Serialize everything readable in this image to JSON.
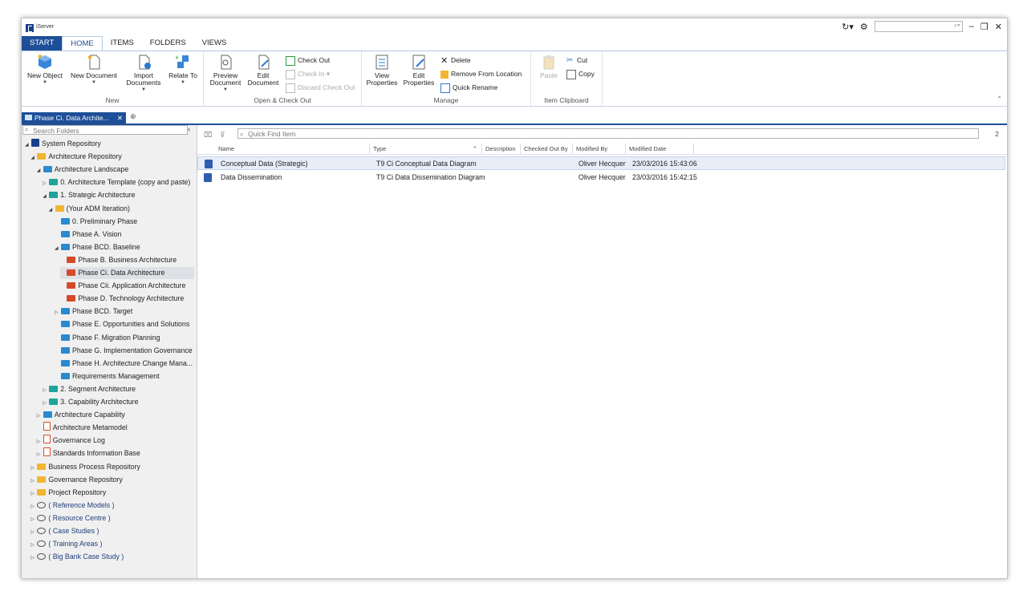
{
  "app": {
    "title": "iServer"
  },
  "ribbon_tabs": [
    "START",
    "HOME",
    "ITEMS",
    "FOLDERS",
    "VIEWS"
  ],
  "groups": {
    "new": {
      "label": "New",
      "new_object": "New Object",
      "new_document": "New Document",
      "import_documents_1": "Import",
      "import_documents_2": "Documents",
      "relate_to": "Relate To"
    },
    "open": {
      "label": "Open & Check Out",
      "preview_1": "Preview",
      "preview_2": "Document",
      "edit_1": "Edit",
      "edit_2": "Document",
      "check_out": "Check Out",
      "check_in": "Check In",
      "discard": "Discard Check Out"
    },
    "manage": {
      "label": "Manage",
      "view_1": "View",
      "view_2": "Properties",
      "editp_1": "Edit",
      "editp_2": "Properties",
      "delete": "Delete",
      "remove": "Remove From Location",
      "rename": "Quick Rename"
    },
    "clipboard": {
      "label": "Item Clipboard",
      "paste": "Paste",
      "cut": "Cut",
      "copy": "Copy"
    }
  },
  "doc_tab": {
    "label": "Phase Ci. Data Archite..."
  },
  "left": {
    "search_placeholder": "Search Folders"
  },
  "tree": [
    {
      "label": "System Repository",
      "indent": 0,
      "toggle": "◢",
      "icon": "sysicon",
      "name": "tree-system-repository"
    },
    {
      "label": "Architecture Repository",
      "indent": 1,
      "toggle": "◢",
      "icon": "f-orange",
      "name": "tree-architecture-repository"
    },
    {
      "label": "Architecture Landscape",
      "indent": 2,
      "toggle": "◢",
      "icon": "f-blue",
      "name": "tree-architecture-landscape"
    },
    {
      "label": "0. Architecture Template (copy and paste)",
      "indent": 3,
      "toggle": "▷",
      "icon": "f-teal",
      "name": "tree-architecture-template"
    },
    {
      "label": "1. Strategic Architecture",
      "indent": 3,
      "toggle": "◢",
      "icon": "f-teal",
      "name": "tree-strategic-architecture"
    },
    {
      "label": "(Your ADM Iteration)",
      "indent": 4,
      "toggle": "◢",
      "icon": "f-orange",
      "name": "tree-your-adm-iteration"
    },
    {
      "label": "0. Preliminary Phase",
      "indent": 5,
      "toggle": "",
      "icon": "f-blue",
      "name": "tree-preliminary-phase"
    },
    {
      "label": "Phase A. Vision",
      "indent": 5,
      "toggle": "",
      "icon": "f-blue",
      "name": "tree-phase-a-vision"
    },
    {
      "label": "Phase BCD. Baseline",
      "indent": 5,
      "toggle": "◢",
      "icon": "f-blue",
      "name": "tree-phase-bcd-baseline"
    },
    {
      "label": "Phase B. Business Architecture",
      "indent": 6,
      "toggle": "",
      "icon": "f-red",
      "name": "tree-phase-b-business"
    },
    {
      "label": "Phase Ci. Data Architecture",
      "indent": 6,
      "toggle": "",
      "icon": "f-red",
      "name": "tree-phase-ci-data",
      "sel": true
    },
    {
      "label": "Phase Cii. Application Architecture",
      "indent": 6,
      "toggle": "",
      "icon": "f-red",
      "name": "tree-phase-cii-application"
    },
    {
      "label": "Phase D. Technology Architecture",
      "indent": 6,
      "toggle": "",
      "icon": "f-red",
      "name": "tree-phase-d-technology"
    },
    {
      "label": "Phase BCD. Target",
      "indent": 5,
      "toggle": "▷",
      "icon": "f-blue",
      "name": "tree-phase-bcd-target"
    },
    {
      "label": "Phase E. Opportunities and Solutions",
      "indent": 5,
      "toggle": "",
      "icon": "f-blue",
      "name": "tree-phase-e"
    },
    {
      "label": "Phase F. Migration Planning",
      "indent": 5,
      "toggle": "",
      "icon": "f-blue",
      "name": "tree-phase-f"
    },
    {
      "label": "Phase G. Implementation Governance",
      "indent": 5,
      "toggle": "",
      "icon": "f-blue",
      "name": "tree-phase-g"
    },
    {
      "label": "Phase H. Architecture Change Mana...",
      "indent": 5,
      "toggle": "",
      "icon": "f-blue",
      "name": "tree-phase-h"
    },
    {
      "label": "Requirements Management",
      "indent": 5,
      "toggle": "",
      "icon": "f-blue",
      "name": "tree-requirements-management"
    },
    {
      "label": "2. Segment Architecture",
      "indent": 3,
      "toggle": "▷",
      "icon": "f-teal",
      "name": "tree-segment-architecture"
    },
    {
      "label": "3. Capability Architecture",
      "indent": 3,
      "toggle": "▷",
      "icon": "f-teal",
      "name": "tree-capability-architecture"
    },
    {
      "label": "Architecture Capability",
      "indent": 2,
      "toggle": "▷",
      "icon": "f-blue",
      "name": "tree-architecture-capability"
    },
    {
      "label": "Architecture Metamodel",
      "indent": 2,
      "toggle": "",
      "icon": "doc-red",
      "name": "tree-architecture-metamodel"
    },
    {
      "label": "Governance Log",
      "indent": 2,
      "toggle": "▷",
      "icon": "doc-red",
      "name": "tree-governance-log"
    },
    {
      "label": "Standards Information Base",
      "indent": 2,
      "toggle": "▷",
      "icon": "doc-red",
      "name": "tree-standards-information-base"
    },
    {
      "label": "Business Process Repository",
      "indent": 1,
      "toggle": "▷",
      "icon": "f-orange",
      "name": "tree-business-process-repository"
    },
    {
      "label": "Governance Repository",
      "indent": 1,
      "toggle": "▷",
      "icon": "f-orange",
      "name": "tree-governance-repository"
    },
    {
      "label": "Project Repository",
      "indent": 1,
      "toggle": "▷",
      "icon": "f-orange",
      "name": "tree-project-repository"
    },
    {
      "label": "( Reference Models )",
      "indent": 1,
      "toggle": "▷",
      "icon": "layers",
      "name": "tree-reference-models",
      "blue": true
    },
    {
      "label": "( Resource Centre )",
      "indent": 1,
      "toggle": "▷",
      "icon": "layers",
      "name": "tree-resource-centre",
      "blue": true
    },
    {
      "label": "( Case Studies )",
      "indent": 1,
      "toggle": "▷",
      "icon": "layers",
      "name": "tree-case-studies",
      "blue": true
    },
    {
      "label": "( Training Areas )",
      "indent": 1,
      "toggle": "▷",
      "icon": "layers",
      "name": "tree-training-areas",
      "blue": true
    },
    {
      "label": "( Big Bank Case Study )",
      "indent": 1,
      "toggle": "▷",
      "icon": "layers",
      "name": "tree-big-bank-case-study",
      "blue": true
    }
  ],
  "right": {
    "quick_find_placeholder": "Quick Find Item",
    "count": "2",
    "columns": {
      "name": "Name",
      "type": "Type",
      "description": "Description",
      "checked_out_by": "Checked Out By",
      "modified_by": "Modified By",
      "modified_date": "Modified Date"
    },
    "rows": [
      {
        "name": "Conceptual Data (Strategic)",
        "type": "T9 Ci Conceptual Data Diagram",
        "modified_by": "Oliver Hecquer",
        "modified_date": "23/03/2016 15:43:06"
      },
      {
        "name": "Data Dissemination",
        "type": "T9 Ci Data Dissemination Diagram",
        "modified_by": "Oliver Hecquer",
        "modified_date": "23/03/2016 15:42:15"
      }
    ]
  }
}
